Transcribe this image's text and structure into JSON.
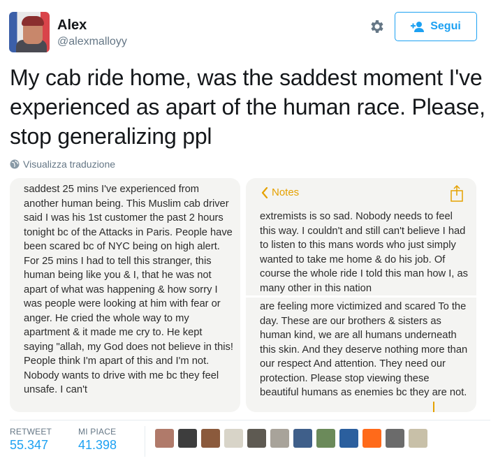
{
  "user": {
    "display_name": "Alex",
    "handle": "@alexmalloyy"
  },
  "actions": {
    "follow_label": "Segui",
    "gear_icon": "gear-icon",
    "follow_icon": "add-person-icon"
  },
  "tweet": {
    "text": "My cab ride home, was the saddest moment I've experienced as apart of the human race. Please, stop generalizing ppl",
    "translate_label": "Visualizza traduzione"
  },
  "media": {
    "left_note": "saddest 25 mins I've experienced from another human being. This Muslim cab driver said I was his 1st customer the past 2 hours tonight bc of the Attacks in Paris. People have been scared bc of NYC being on high alert. For 25 mins I had to tell this stranger, this human being like you & I, that he was not apart of what was happening & how sorry I was people were looking at him with fear or anger. He cried the whole way to my apartment & it made me cry to. He kept saying \"allah, my God does not believe in this! People think I'm apart of this and I'm not. Nobody wants to drive with me bc they feel unsafe. I can't",
    "notes_back_label": "Notes",
    "right_note_top": "extremists is so sad. Nobody needs to feel this way. I couldn't and still can't believe I had to listen to this mans words who just simply wanted to take me home & do his job. Of course the whole ride I told this man how I, as many other in this nation",
    "right_note_bottom": "are feeling more victimized and scared To the day. These are our brothers & sisters as human kind, we are all humans underneath this skin. And they deserve nothing more than our respect And attention. They need our protection. Please stop viewing these beautiful humans as enemies bc they are not."
  },
  "stats": {
    "retweets_label": "RETWEET",
    "retweets_value": "55.347",
    "likes_label": "MI PIACE",
    "likes_value": "41.398"
  },
  "likers": {
    "colors": [
      "#b07a6a",
      "#3d3d3d",
      "#8b5a3c",
      "#d8d4c8",
      "#5e5a52",
      "#a8a39a",
      "#3f5f8a",
      "#6b8a5a",
      "#2b5f9e",
      "#ff6a1a",
      "#6b6b6b",
      "#c8c0a8"
    ]
  },
  "theme": {
    "accent": "#1da1f2",
    "notes_accent": "#e5a100"
  }
}
